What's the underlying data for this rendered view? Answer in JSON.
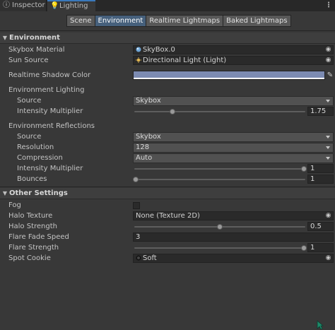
{
  "tabs": [
    {
      "label": "Inspector",
      "icon": "info-icon"
    },
    {
      "label": "Lighting",
      "icon": "lightbulb-icon"
    }
  ],
  "toolbar": [
    "Scene",
    "Environment",
    "Realtime Lightmaps",
    "Baked Lightmaps"
  ],
  "selected_toolbar": "Environment",
  "environment": {
    "header": "Environment",
    "skybox_label": "Skybox Material",
    "skybox_value": "SkyBox.0",
    "sun_label": "Sun Source",
    "sun_value": "Directional Light (Light)",
    "shadow_label": "Realtime Shadow Color",
    "shadow_color": "#7c8bb2",
    "lighting_group": "Environment Lighting",
    "light_source_label": "Source",
    "light_source_value": "Skybox",
    "light_intensity_label": "Intensity Multiplier",
    "light_intensity_value": "1.75",
    "light_intensity_fraction": 0.22,
    "reflections_group": "Environment Reflections",
    "refl_source_label": "Source",
    "refl_source_value": "Skybox",
    "resolution_label": "Resolution",
    "resolution_value": "128",
    "compression_label": "Compression",
    "compression_value": "Auto",
    "refl_intensity_label": "Intensity Multiplier",
    "refl_intensity_value": "1",
    "refl_intensity_fraction": 1.0,
    "bounces_label": "Bounces",
    "bounces_value": "1",
    "bounces_fraction": 0.0
  },
  "other": {
    "header": "Other Settings",
    "fog_label": "Fog",
    "halo_texture_label": "Halo Texture",
    "halo_texture_value": "None (Texture 2D)",
    "halo_strength_label": "Halo Strength",
    "halo_strength_value": "0.5",
    "halo_strength_fraction": 0.5,
    "flare_fade_label": "Flare Fade Speed",
    "flare_fade_value": "3",
    "flare_strength_label": "Flare Strength",
    "flare_strength_value": "1",
    "flare_strength_fraction": 1.0,
    "spot_cookie_label": "Spot Cookie",
    "spot_cookie_value": "Soft"
  }
}
